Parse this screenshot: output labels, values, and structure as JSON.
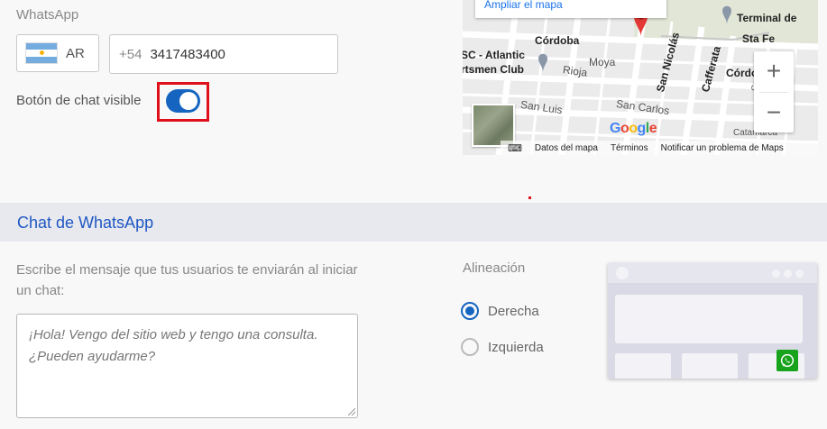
{
  "whatsapp": {
    "label": "WhatsApp",
    "country_code": "AR",
    "phone_prefix": "+54",
    "phone_number": "3417483400",
    "chat_visible_label": "Botón de chat visible",
    "chat_visible": true
  },
  "map": {
    "expand_link": "Ampliar el mapa",
    "places": [
      {
        "name": "Terminal de"
      },
      {
        "name": "Sta Fe"
      },
      {
        "name": "Córdoba"
      },
      {
        "name": "SC - Atlantic"
      },
      {
        "name": "rtsmen Club"
      },
      {
        "name": "Moya"
      },
      {
        "name": "Rioja"
      },
      {
        "name": "Córdo"
      },
      {
        "name": "San Luis"
      },
      {
        "name": "San Carlos"
      },
      {
        "name": "San Nicolás"
      },
      {
        "name": "Cafferata"
      },
      {
        "name": "Gould"
      },
      {
        "name": "Catamarca"
      }
    ],
    "footer": {
      "data_label": "Datos del mapa",
      "terms_label": "Términos",
      "report_label": "Notificar un problema de Maps"
    },
    "google_label": "Google",
    "zoom_in": "+",
    "zoom_out": "−"
  },
  "chat_section": {
    "title": "Chat de WhatsApp",
    "message_label": "Escribe el mensaje que tus usuarios te enviarán al iniciar un chat:",
    "message_text": "¡Hola! Vengo del sitio web y tengo una consulta. ¿Pueden ayudarme?",
    "alignment_label": "Alineación",
    "alignment_options": [
      {
        "label": "Derecha",
        "selected": true
      },
      {
        "label": "Izquierda",
        "selected": false
      }
    ]
  },
  "colors": {
    "accent": "#1565c0",
    "title_blue": "#1f57c3",
    "highlight_red": "#e0101a",
    "whatsapp_green": "#18a31c"
  }
}
